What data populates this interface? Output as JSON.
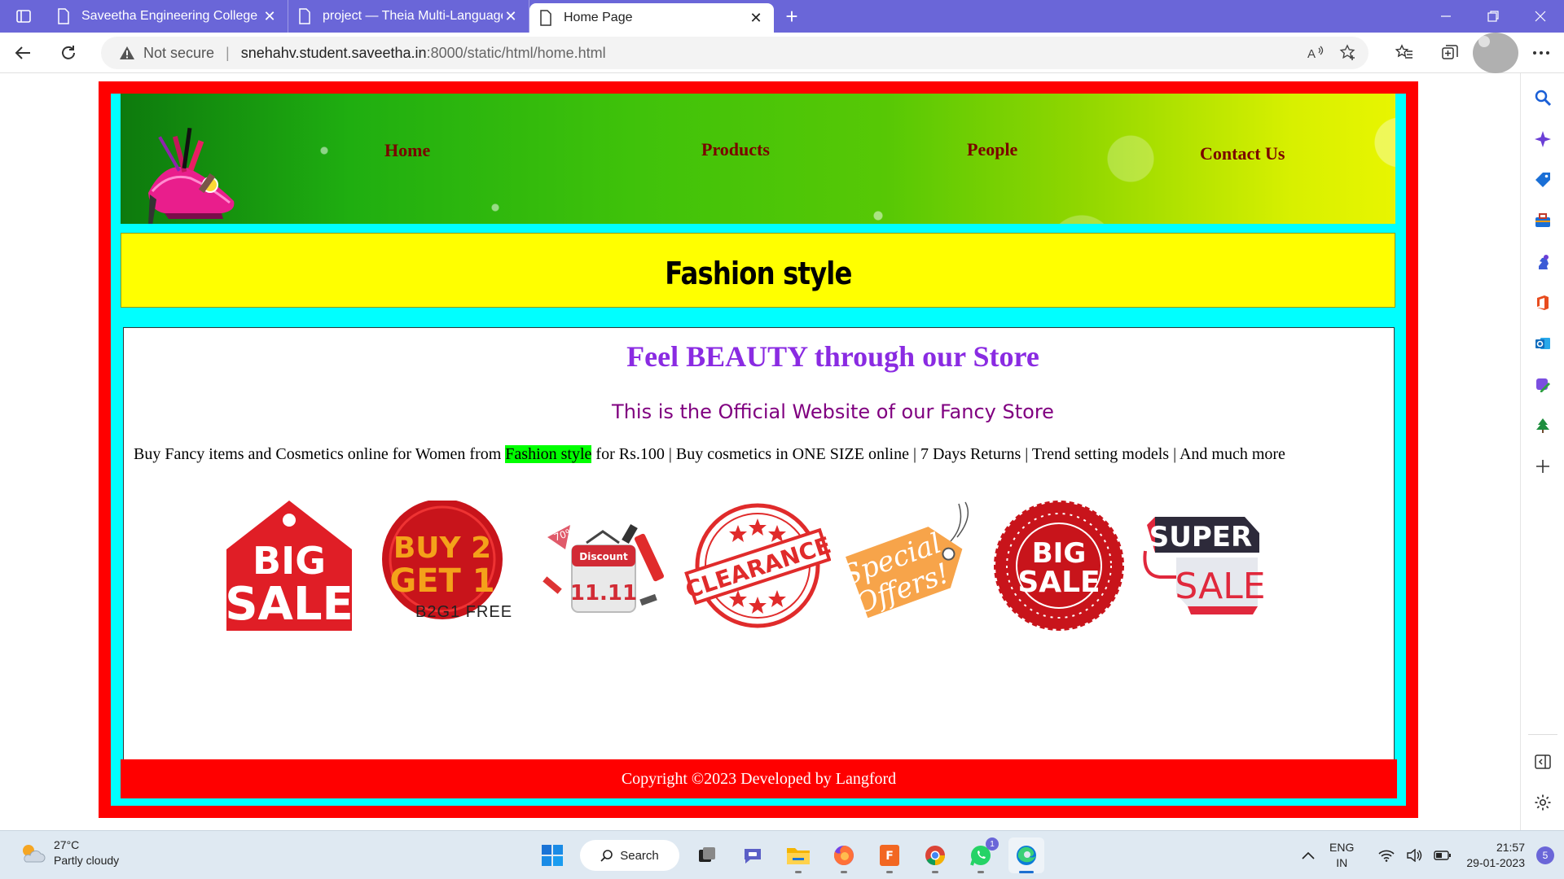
{
  "browser": {
    "tabs": [
      {
        "label": "Saveetha Engineering College",
        "active": false
      },
      {
        "label": "project — Theia Multi-Language",
        "active": false
      },
      {
        "label": "Home Page",
        "active": true
      }
    ],
    "security_label": "Not secure",
    "url_host": "snehahv.student.saveetha.in",
    "url_rest": ":8000/static/html/home.html"
  },
  "page": {
    "nav": {
      "home": "Home",
      "products": "Products",
      "people": "People",
      "contact": "Contact Us"
    },
    "banner_title": "Fashion style",
    "tagline": "Feel BEAUTY through our Store",
    "subtitle": "This is the Official Website of our Fancy Store",
    "promo_before": "Buy Fancy items and Cosmetics online for Women from ",
    "promo_highlight": "Fashion style",
    "promo_after": " for Rs.100 | Buy cosmetics in ONE SIZE online | 7 Days Returns | Trend setting models | And much more",
    "offers": {
      "big_sale_1": {
        "line1": "BIG",
        "line2": "SALE"
      },
      "b2g1": {
        "line1": "BUY 2",
        "line2": "GET 1",
        "caption": "B2G1 FREE"
      },
      "discount": {
        "label": "Discount",
        "date": "11.11",
        "tag": "70%"
      },
      "clearance": {
        "label": "CLEARANCE"
      },
      "special": {
        "line1": "Special",
        "line2": "Offers!"
      },
      "big_sale_2": {
        "line1": "BIG",
        "line2": "SALE"
      },
      "super_sale": {
        "line1": "SUPER",
        "line2": "SALE"
      }
    },
    "footer": "Copyright ©2023 Developed by Langford"
  },
  "taskbar": {
    "temperature": "27°C",
    "weather": "Partly cloudy",
    "search_label": "Search",
    "whatsapp_badge": "1",
    "lang_line1": "ENG",
    "lang_line2": "IN",
    "time": "21:57",
    "date": "29-01-2023",
    "notifications": "5"
  },
  "colors": {
    "tabbar": "#6a66d8",
    "page_border": "#ff0000",
    "page_fill": "#00ffff",
    "banner": "#ffff00",
    "tagline": "#8a2be2",
    "subtitle": "#800080",
    "nav_link": "#7a0000",
    "highlight": "#00ff00"
  }
}
